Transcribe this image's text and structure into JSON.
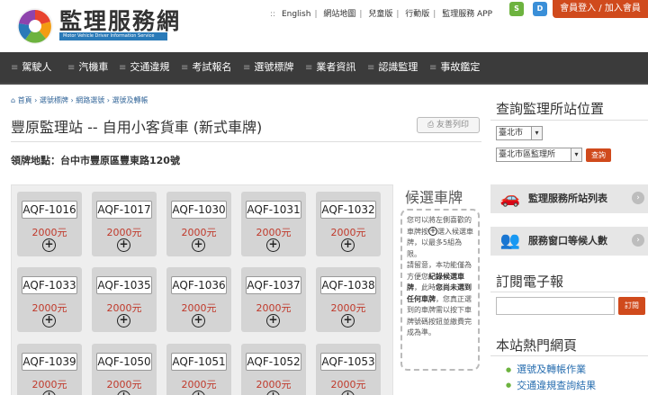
{
  "header": {
    "site_title": "監理服務網",
    "site_subtitle": "Motor Vehicle Driver Information Service",
    "top_links": [
      "English",
      "網站地圖",
      "兒童版",
      "行動版",
      "監理服務 APP"
    ],
    "app_icons": [
      "S",
      "D"
    ],
    "login_label": "會員登入 / 加入會員"
  },
  "nav": {
    "items": [
      "駕駛人",
      "汽機車",
      "交通違規",
      "考試報名",
      "選號標牌",
      "業者資訊",
      "認識監理",
      "事故鑑定"
    ]
  },
  "breadcrumb": [
    "首頁",
    "選號標牌",
    "網路選號",
    "選號及轉帳"
  ],
  "page": {
    "title": "豐原監理站 -- 自用小客貨車 (新式車牌)",
    "print_label": "友善列印",
    "location_label": "領牌地點：",
    "location_value": "台中市豐原區豐東路120號"
  },
  "plates": [
    {
      "number": "AQF-1016",
      "price": "2000元"
    },
    {
      "number": "AQF-1017",
      "price": "2000元"
    },
    {
      "number": "AQF-1030",
      "price": "2000元"
    },
    {
      "number": "AQF-1031",
      "price": "2000元"
    },
    {
      "number": "AQF-1032",
      "price": "2000元"
    },
    {
      "number": "AQF-1033",
      "price": "2000元"
    },
    {
      "number": "AQF-1035",
      "price": "2000元"
    },
    {
      "number": "AQF-1036",
      "price": "2000元"
    },
    {
      "number": "AQF-1037",
      "price": "2000元"
    },
    {
      "number": "AQF-1038",
      "price": "2000元"
    },
    {
      "number": "AQF-1039",
      "price": "2000元"
    },
    {
      "number": "AQF-1050",
      "price": "2000元"
    },
    {
      "number": "AQF-1051",
      "price": "2000元"
    },
    {
      "number": "AQF-1052",
      "price": "2000元"
    },
    {
      "number": "AQF-1053",
      "price": "2000元"
    }
  ],
  "candidates": {
    "title": "候選車牌",
    "text_1": "您可以將左側喜歡的車牌按",
    "text_2": "選入候選車牌，以最多5組為限。",
    "text_3": "請留意，本功能僅為方便您",
    "bold_1": "紀錄候選車牌",
    "text_4": "，此時",
    "bold_2": "您尚未選到任何車牌",
    "text_5": "，您真正選到的車牌需以按下車牌號碼按鈕並繳費完成為準。"
  },
  "sidebar": {
    "station_title": "查詢監理所站位置",
    "city_select": "臺北市",
    "office_select": "臺北市區監理所",
    "query_label": "查詢",
    "banner_stations": "監理服務所站列表",
    "banner_waiting": "服務窗口等候人數",
    "subscribe_title": "訂閱電子報",
    "subscribe_button": "訂閱",
    "hot_title": "本站熱門網頁",
    "hot_links": [
      "選號及轉帳作業",
      "交通違規查詢結果"
    ]
  },
  "colors": {
    "accent": "#d04a1c",
    "nav_bg": "#3b3b3b",
    "price": "#c0392b",
    "link": "#2a6fb0"
  }
}
